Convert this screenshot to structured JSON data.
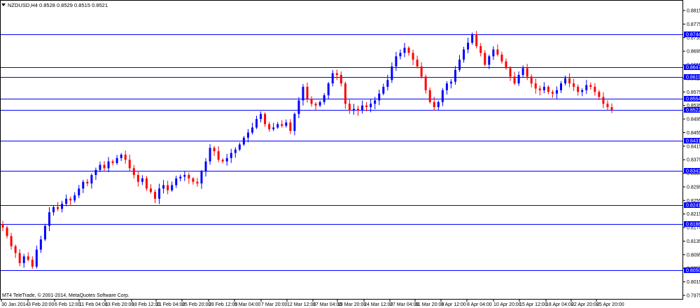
{
  "header": {
    "symbol_line": "NZDUSD,H4  0.8528 0.8529 0.8515 0.8521"
  },
  "footer": {
    "copyright": "MT4 TeleTrade, © 2001-2014, MetaQuotes Software Corp."
  },
  "colors": {
    "bull": "#0000ff",
    "bear": "#ff0000",
    "level_line": "#0000ff",
    "level_label_bg": "#0000ff",
    "axis": "#000000",
    "background": "#ffffff"
  },
  "chart_data": {
    "type": "candlestick",
    "symbol": "NZDUSD",
    "timeframe": "H4",
    "last": {
      "open": 0.8528,
      "high": 0.8529,
      "low": 0.8515,
      "close": 0.8521
    },
    "ylim": [
      0.7975,
      0.8835
    ],
    "y_ticks": [
      "0.8815",
      "0.8775",
      "0.8735",
      "0.8695",
      "0.8655",
      "0.8615",
      "0.8575",
      "0.8535",
      "0.8495",
      "0.8455",
      "0.8415",
      "0.8375",
      "0.8335",
      "0.8295",
      "0.8255",
      "0.8215",
      "0.8175",
      "0.8135",
      "0.8095",
      "0.8055",
      "0.8015",
      "0.7975"
    ],
    "x_labels": [
      "30 Jan 2014",
      "3 Feb 20:00",
      "6 Feb 12:00",
      "11 Feb 04:00",
      "13 Feb 20:00",
      "18 Feb 12:00",
      "21 Feb 04:00",
      "25 Feb 20:00",
      "28 Feb 12:00",
      "5 Mar 04:00",
      "7 Mar 20:00",
      "12 Mar 12:00",
      "17 Mar 04:00",
      "19 Mar 20:00",
      "24 Mar 12:00",
      "27 Mar 04:00",
      "31 Mar 20:00",
      "3 Apr 12:00",
      "8 Apr 04:00",
      "10 Apr 20:00",
      "15 Apr 12:00",
      "18 Apr 04:00",
      "22 Apr 20:00",
      "25 Apr 20:00"
    ],
    "levels": [
      {
        "value": 0.8744,
        "label": "0.8744"
      },
      {
        "value": 0.8647,
        "label": "0.8647"
      },
      {
        "value": 0.8619,
        "label": "0.8619"
      },
      {
        "value": 0.8554,
        "label": "0.8554"
      },
      {
        "value": 0.8522,
        "label": "0.8522"
      },
      {
        "value": 0.8431,
        "label": "0.8431"
      },
      {
        "value": 0.8342,
        "label": "0.8342"
      },
      {
        "value": 0.8241,
        "label": "0.8241"
      },
      {
        "value": 0.8186,
        "label": "0.8186"
      },
      {
        "value": 0.805,
        "label": "0.8050"
      }
    ],
    "close_path": [
      0.8175,
      0.815,
      0.812,
      0.81,
      0.807,
      0.809,
      0.808,
      0.806,
      0.811,
      0.814,
      0.818,
      0.822,
      0.8235,
      0.823,
      0.8245,
      0.826,
      0.8255,
      0.827,
      0.829,
      0.831,
      0.8305,
      0.833,
      0.8345,
      0.836,
      0.835,
      0.837,
      0.8365,
      0.838,
      0.839,
      0.8375,
      0.835,
      0.833,
      0.831,
      0.832,
      0.829,
      0.828,
      0.826,
      0.829,
      0.83,
      0.8285,
      0.83,
      0.832,
      0.8325,
      0.833,
      0.832,
      0.831,
      0.8305,
      0.834,
      0.837,
      0.841,
      0.84,
      0.8375,
      0.837,
      0.838,
      0.8395,
      0.8405,
      0.842,
      0.844,
      0.8455,
      0.847,
      0.8495,
      0.851,
      0.848,
      0.8465,
      0.847,
      0.848,
      0.8475,
      0.8485,
      0.846,
      0.851,
      0.855,
      0.859,
      0.8555,
      0.854,
      0.8535,
      0.8545,
      0.8565,
      0.86,
      0.863,
      0.8625,
      0.86,
      0.854,
      0.852,
      0.8525,
      0.852,
      0.8535,
      0.853,
      0.854,
      0.855,
      0.857,
      0.859,
      0.861,
      0.865,
      0.868,
      0.869,
      0.8705,
      0.869,
      0.867,
      0.865,
      0.862,
      0.858,
      0.8545,
      0.853,
      0.8545,
      0.858,
      0.86,
      0.8605,
      0.864,
      0.867,
      0.87,
      0.872,
      0.8745,
      0.871,
      0.869,
      0.8655,
      0.868,
      0.87,
      0.8685,
      0.8665,
      0.8645,
      0.862,
      0.86,
      0.8625,
      0.8645,
      0.862,
      0.86,
      0.8585,
      0.858,
      0.859,
      0.8575,
      0.857,
      0.858,
      0.86,
      0.8615,
      0.86,
      0.859,
      0.8575,
      0.858,
      0.8595,
      0.859,
      0.8575,
      0.856,
      0.854,
      0.853,
      0.8521
    ]
  }
}
